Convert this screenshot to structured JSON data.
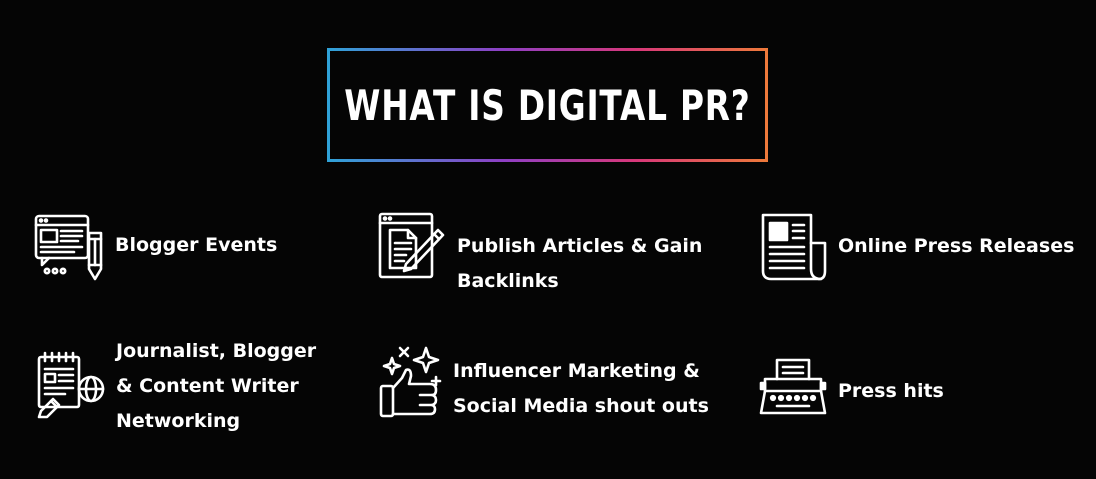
{
  "title": "WHAT IS DIGITAL PR?",
  "colors": {
    "background": "#050505",
    "text": "#ffffff",
    "frame_gradient": [
      "#2fa3d8",
      "#8e3fc4",
      "#d8387a",
      "#ee7a3a"
    ]
  },
  "items": [
    {
      "icon": "blogger-events-icon",
      "lines": [
        "Blogger Events"
      ]
    },
    {
      "icon": "publish-articles-icon",
      "lines": [
        "Publish Articles & Gain",
        "Backlinks"
      ]
    },
    {
      "icon": "newspaper-icon",
      "lines": [
        "Online Press Releases"
      ]
    },
    {
      "icon": "networking-icon",
      "lines": [
        "Journalist, Blogger",
        "& Content Writer",
        "Networking"
      ]
    },
    {
      "icon": "thumbs-up-sparkle-icon",
      "lines": [
        "Influencer Marketing &",
        "Social Media shout outs"
      ]
    },
    {
      "icon": "typewriter-icon",
      "lines": [
        "Press hits"
      ]
    }
  ]
}
